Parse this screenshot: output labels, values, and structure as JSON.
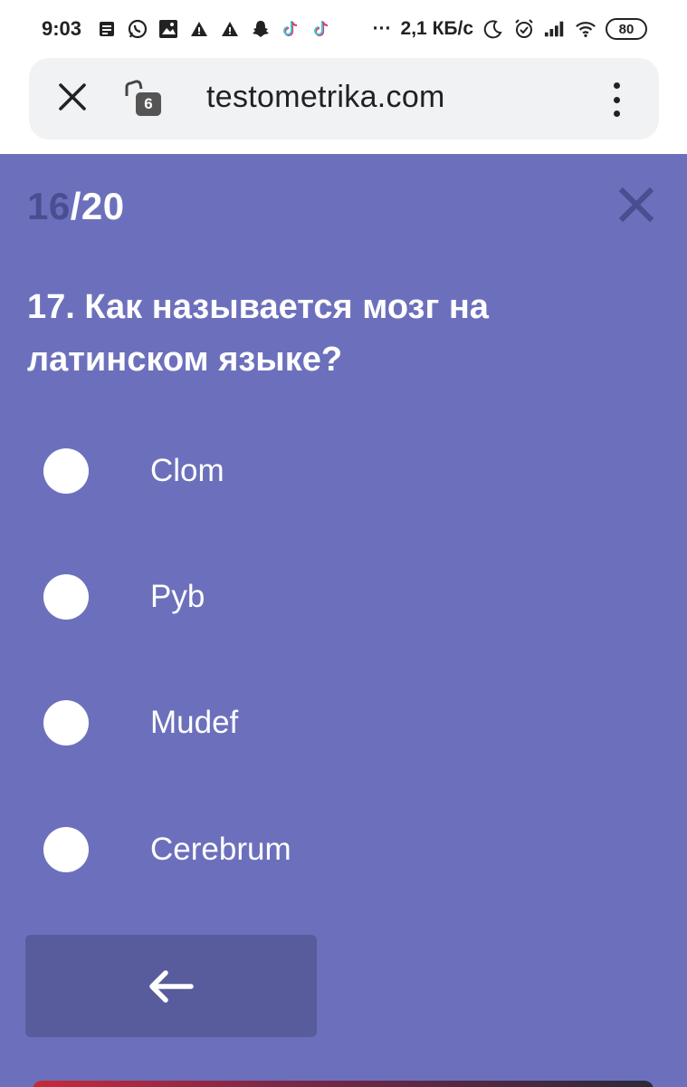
{
  "status_bar": {
    "time": "9:03",
    "left_icons": [
      "notes-icon",
      "whatsapp-icon",
      "gallery-icon",
      "warning-icon",
      "warning-icon",
      "snapchat-icon",
      "tiktok-icon",
      "tiktok-icon"
    ],
    "more": "···",
    "network_speed": "2,1 КБ/с",
    "battery": "80",
    "right_icons": [
      "moon-icon",
      "alarm-icon",
      "signal-icon",
      "wifi-icon"
    ]
  },
  "browser": {
    "tab_count": "6",
    "url": "testometrika.com"
  },
  "quiz": {
    "progress": {
      "current": "16",
      "separator": "/",
      "total": "20"
    },
    "question": "17. Как называется мозг на латинском языке?",
    "options": [
      "Clom",
      "Pyb",
      "Mudef",
      "Cerebrum"
    ]
  },
  "colors": {
    "background": "#6c70bc",
    "counter_current": "#4a4d8f",
    "back_button": "#585c9c",
    "text": "#ffffff"
  }
}
